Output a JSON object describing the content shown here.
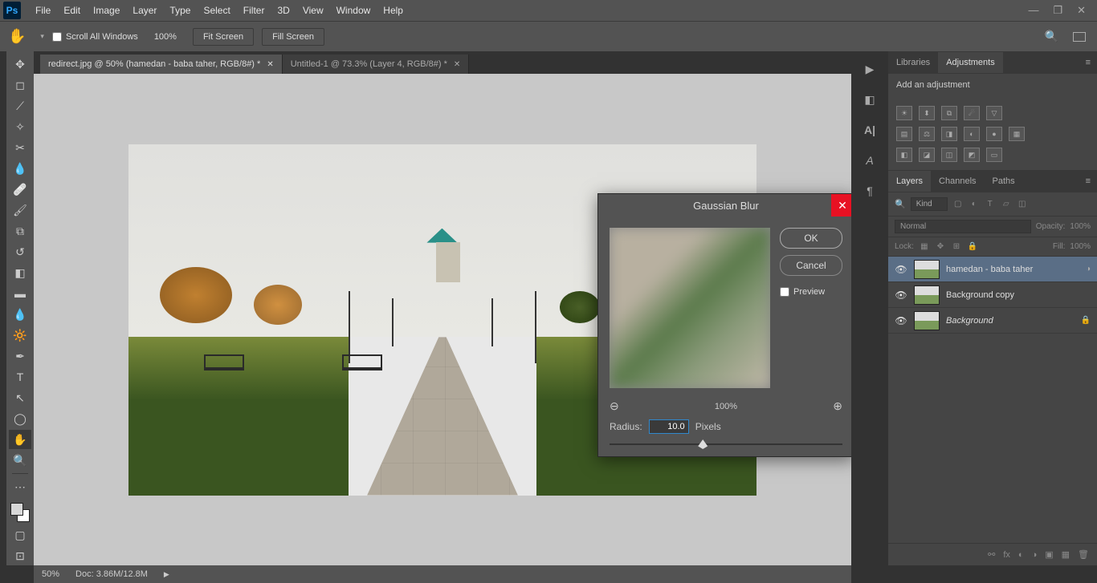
{
  "menu": {
    "items": [
      "File",
      "Edit",
      "Image",
      "Layer",
      "Type",
      "Select",
      "Filter",
      "3D",
      "View",
      "Window",
      "Help"
    ]
  },
  "options": {
    "scroll_all": "Scroll All Windows",
    "zoom": "100%",
    "fit": "Fit Screen",
    "fill": "Fill Screen"
  },
  "tabs": [
    {
      "label": "redirect.jpg @ 50% (hamedan - baba taher, RGB/8#) *",
      "active": true
    },
    {
      "label": "Untitled-1 @ 73.3% (Layer 4, RGB/8#) *",
      "active": false
    }
  ],
  "dialog": {
    "title": "Gaussian Blur",
    "ok": "OK",
    "cancel": "Cancel",
    "preview": "Preview",
    "zoom": "100%",
    "radius_label": "Radius:",
    "radius_value": "10.0",
    "unit": "Pixels"
  },
  "panels": {
    "libraries": "Libraries",
    "adjustments": "Adjustments",
    "adj_title": "Add an adjustment",
    "layers": "Layers",
    "channels": "Channels",
    "paths": "Paths",
    "kind": "Kind",
    "blend": "Normal",
    "opacity_label": "Opacity:",
    "opacity": "100%",
    "lock_label": "Lock:",
    "fill_label": "Fill:",
    "fill": "100%"
  },
  "layers": [
    {
      "name": "hamedan - baba taher",
      "selected": true,
      "smart": true
    },
    {
      "name": "Background copy",
      "selected": false
    },
    {
      "name": "Background",
      "selected": false,
      "locked": true,
      "italic": true
    }
  ],
  "status": {
    "zoom": "50%",
    "doc": "Doc: 3.86M/12.8M"
  }
}
